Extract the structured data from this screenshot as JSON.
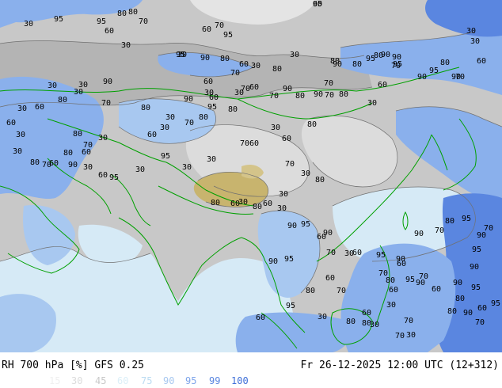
{
  "header": {
    "title": "RH 700 hPa [%] GFS 0.25",
    "runtime": "Fr 26-12-2025 12:00 UTC (12+312)"
  },
  "legend": {
    "values": [
      "15",
      "30",
      "45",
      "60",
      "75",
      "90",
      "95",
      "99",
      "100"
    ],
    "colors": [
      "#f0f0f0",
      "#dcdcdc",
      "#c8c8c8",
      "#dbeff8",
      "#bcdcf2",
      "#a8c8f0",
      "#7fa5ea",
      "#5a86e0",
      "#3e6fd8"
    ]
  },
  "palette": {
    "dry": "#b4b4b4",
    "medium": "#c8c8c8",
    "light": "#dcdcdc",
    "moist": "#8ab0ec",
    "very_moist": "#5a86e0",
    "desert": "#c8b46e",
    "pale_blue": "#d6eaf6",
    "border": "#00a000",
    "contour": "#707070"
  },
  "map": {
    "contour_labels": [
      {
        "text": "60"
      },
      {
        "text": "30"
      },
      {
        "text": "95"
      },
      {
        "text": "95"
      },
      {
        "text": "80"
      },
      {
        "text": "70"
      },
      {
        "text": "60"
      },
      {
        "text": "80"
      },
      {
        "text": "70"
      },
      {
        "text": "60"
      },
      {
        "text": "95"
      },
      {
        "text": "30"
      },
      {
        "text": "30"
      },
      {
        "text": "95"
      },
      {
        "text": "90"
      },
      {
        "text": "80"
      },
      {
        "text": "60"
      },
      {
        "text": "30"
      },
      {
        "text": "80"
      },
      {
        "text": "70"
      },
      {
        "text": "30"
      },
      {
        "text": "90"
      },
      {
        "text": "80"
      },
      {
        "text": "95"
      },
      {
        "text": "80"
      },
      {
        "text": "90"
      },
      {
        "text": "90"
      },
      {
        "text": "95"
      },
      {
        "text": "70"
      },
      {
        "text": "90"
      },
      {
        "text": "95"
      },
      {
        "text": "90"
      },
      {
        "text": "30"
      },
      {
        "text": "30"
      },
      {
        "text": "60"
      },
      {
        "text": "80"
      },
      {
        "text": "70"
      },
      {
        "text": "60"
      },
      {
        "text": "80"
      },
      {
        "text": "90"
      },
      {
        "text": "70"
      },
      {
        "text": "80"
      },
      {
        "text": "30"
      },
      {
        "text": "70"
      },
      {
        "text": "80"
      },
      {
        "text": "90"
      },
      {
        "text": "70"
      },
      {
        "text": "60"
      },
      {
        "text": "30"
      },
      {
        "text": "60"
      },
      {
        "text": "30"
      },
      {
        "text": "90"
      },
      {
        "text": "95"
      },
      {
        "text": "80"
      },
      {
        "text": "70"
      },
      {
        "text": "60"
      },
      {
        "text": "80"
      },
      {
        "text": "70"
      },
      {
        "text": "30"
      },
      {
        "text": "30"
      },
      {
        "text": "60"
      },
      {
        "text": "80"
      },
      {
        "text": "70"
      },
      {
        "text": "90"
      },
      {
        "text": "30"
      },
      {
        "text": "30"
      },
      {
        "text": "80"
      },
      {
        "text": "30"
      },
      {
        "text": "60"
      },
      {
        "text": "30"
      },
      {
        "text": "60"
      },
      {
        "text": "30"
      },
      {
        "text": "30"
      },
      {
        "text": "80"
      },
      {
        "text": "70"
      },
      {
        "text": "60"
      },
      {
        "text": "80"
      },
      {
        "text": "60"
      },
      {
        "text": "30"
      },
      {
        "text": "70"
      },
      {
        "text": "80"
      },
      {
        "text": "90"
      },
      {
        "text": "30"
      },
      {
        "text": "60"
      },
      {
        "text": "95"
      },
      {
        "text": "30"
      },
      {
        "text": "95"
      },
      {
        "text": "30"
      },
      {
        "text": "30"
      },
      {
        "text": "70"
      },
      {
        "text": "60"
      },
      {
        "text": "30"
      },
      {
        "text": "80"
      },
      {
        "text": "60"
      },
      {
        "text": "70"
      },
      {
        "text": "30"
      },
      {
        "text": "80"
      },
      {
        "text": "30"
      },
      {
        "text": "30"
      },
      {
        "text": "60"
      },
      {
        "text": "80"
      },
      {
        "text": "60"
      },
      {
        "text": "30"
      },
      {
        "text": "80"
      },
      {
        "text": "90"
      },
      {
        "text": "95"
      },
      {
        "text": "90"
      },
      {
        "text": "30"
      },
      {
        "text": "60"
      },
      {
        "text": "70"
      },
      {
        "text": "80"
      },
      {
        "text": "95"
      },
      {
        "text": "60"
      },
      {
        "text": "30"
      },
      {
        "text": "80"
      },
      {
        "text": "60"
      },
      {
        "text": "30"
      },
      {
        "text": "70"
      },
      {
        "text": "30"
      },
      {
        "text": "60"
      },
      {
        "text": "70"
      },
      {
        "text": "80"
      },
      {
        "text": "90"
      },
      {
        "text": "95"
      },
      {
        "text": "90"
      },
      {
        "text": "95"
      },
      {
        "text": "90"
      },
      {
        "text": "70"
      },
      {
        "text": "95"
      },
      {
        "text": "80"
      },
      {
        "text": "70"
      },
      {
        "text": "90"
      },
      {
        "text": "60"
      },
      {
        "text": "95"
      },
      {
        "text": "90"
      },
      {
        "text": "70"
      },
      {
        "text": "80"
      },
      {
        "text": "60"
      },
      {
        "text": "30"
      },
      {
        "text": "80"
      },
      {
        "text": "60"
      },
      {
        "text": "95"
      },
      {
        "text": "90"
      },
      {
        "text": "70"
      },
      {
        "text": "60"
      },
      {
        "text": "95"
      },
      {
        "text": "90"
      },
      {
        "text": "70"
      },
      {
        "text": "90"
      },
      {
        "text": "80"
      },
      {
        "text": "60"
      },
      {
        "text": "95"
      },
      {
        "text": "70"
      },
      {
        "text": "95"
      }
    ]
  }
}
